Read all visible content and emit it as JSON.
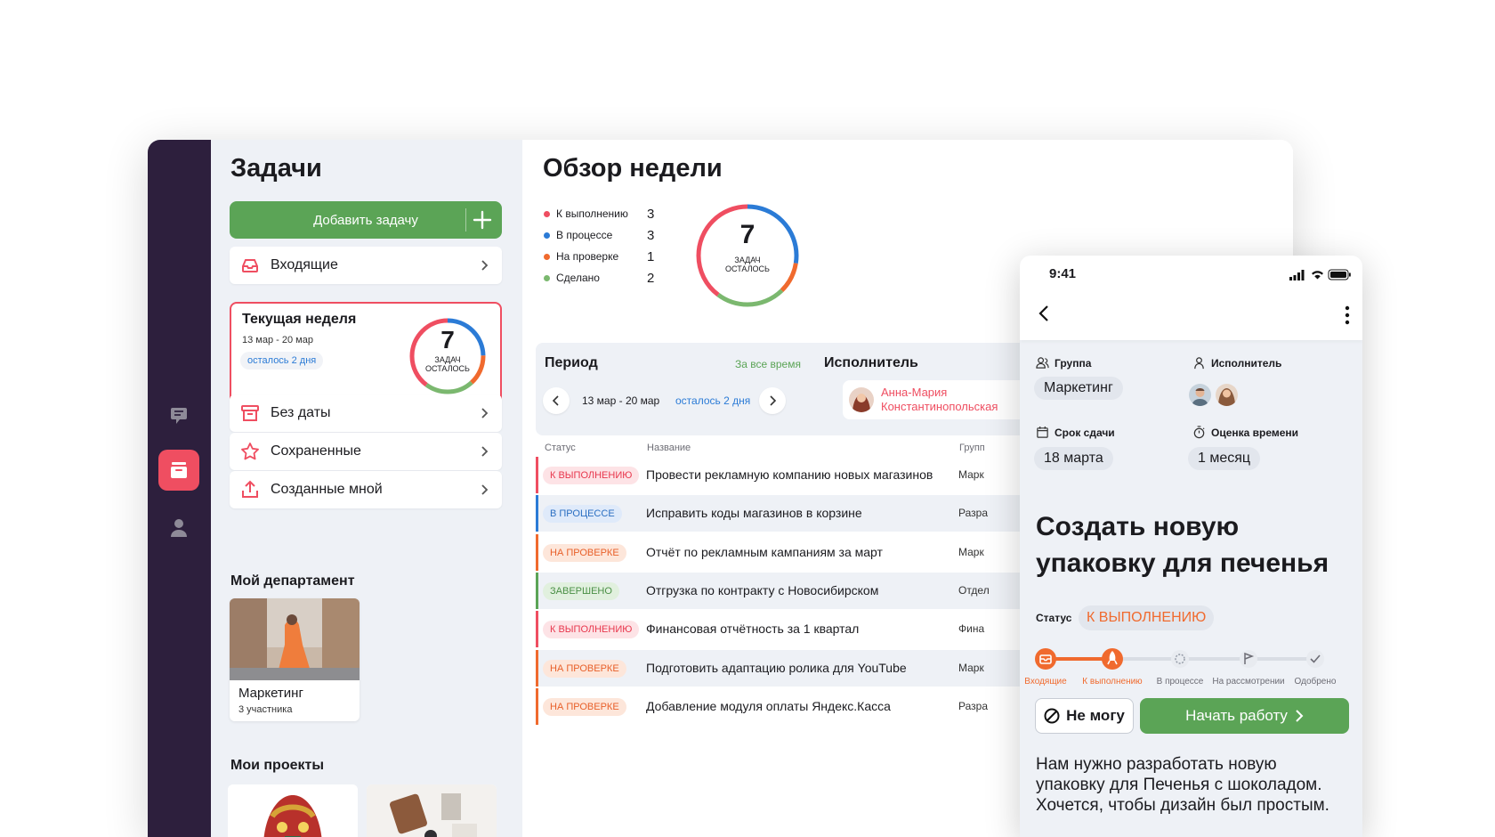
{
  "sidebar": {
    "title": "Задачи",
    "add_task": "Добавить задачу",
    "inbox": "Входящие",
    "current_week": {
      "title": "Текущая неделя",
      "dates": "13 мар - 20 мар",
      "remaining": "осталось 2 дня",
      "count": "7",
      "caption_1": "задач",
      "caption_2": "осталось"
    },
    "no_date": "Без даты",
    "saved": "Сохраненные",
    "created_by_me": "Созданные мной",
    "department_title": "Мой департамент",
    "department": {
      "name": "Маркетинг",
      "members": "3 участника"
    },
    "projects_title": "Мои проекты"
  },
  "overview": {
    "title": "Обзор недели",
    "legend": [
      {
        "label": "К выполнению",
        "count": "3",
        "color": "#ef4e61"
      },
      {
        "label": "В процессе",
        "count": "3",
        "color": "#2b7bd6"
      },
      {
        "label": "На проверке",
        "count": "1",
        "color": "#f06a2e"
      },
      {
        "label": "Сделано",
        "count": "2",
        "color": "#7bb86f"
      }
    ],
    "donut": {
      "count": "7",
      "caption_1": "задач",
      "caption_2": "осталось"
    }
  },
  "filters": {
    "period_label": "Период",
    "all_time": "За все время",
    "dates": "13 мар - 20 мар",
    "remaining": "осталось 2 дня",
    "assignee_label": "Исполнитель",
    "assignee_name_1": "Анна-Мария",
    "assignee_name_2": "Константинопольская"
  },
  "table": {
    "headers": {
      "status": "Статус",
      "name": "Название",
      "group": "Групп"
    },
    "rows": [
      {
        "status": "К выполнению",
        "name": "Провести рекламную компанию новых магазинов",
        "group": "Марк",
        "color": "#ef4e61"
      },
      {
        "status": "В процессе",
        "name": "Исправить коды магазинов в корзине",
        "group": "Разра",
        "color": "#2b7bd6"
      },
      {
        "status": "На проверке",
        "name": "Отчёт по рекламным кампаниям за март",
        "group": "Марк",
        "color": "#f06a2e"
      },
      {
        "status": "Завершено",
        "name": "Отгрузка по контракту с Новосибирском",
        "group": "Отдел",
        "color": "#5ba456"
      },
      {
        "status": "К выполнению",
        "name": "Финансовая отчётность за 1 квартал",
        "group": "Фина",
        "color": "#ef4e61"
      },
      {
        "status": "На проверке",
        "name": "Подготовить адаптацию ролика для YouTube",
        "group": "Марк",
        "color": "#f06a2e"
      },
      {
        "status": "На проверке",
        "name": "Добавление модуля оплаты Яндекс.Касса",
        "group": "Разра",
        "color": "#f06a2e"
      }
    ]
  },
  "phone": {
    "time": "9:41",
    "group_label": "Группа",
    "group_value": "Маркетинг",
    "assignee_label": "Исполнитель",
    "deadline_label": "Срок сдачи",
    "deadline_value": "18 марта",
    "estimate_label": "Оценка времени",
    "estimate_value": "1 месяц",
    "title": "Создать новую упаковку для печенья",
    "status_label": "Статус",
    "status_value": "К ВЫПОЛНЕНИЮ",
    "steps": [
      "Входящие",
      "К выполнению",
      "В процессе",
      "На рассмотрении",
      "Одобрено"
    ],
    "cant_button": "Не могу",
    "start_button": "Начать работу",
    "description": "Нам нужно разработать новую упаковку для Печенья с шоколадом. Хочется, чтобы дизайн был простым."
  },
  "colors": {
    "accent_red": "#ef4e61",
    "accent_green": "#5ba456",
    "accent_blue": "#2b7bd6",
    "accent_orange": "#f06a2e",
    "rail": "#2d1f3d"
  }
}
